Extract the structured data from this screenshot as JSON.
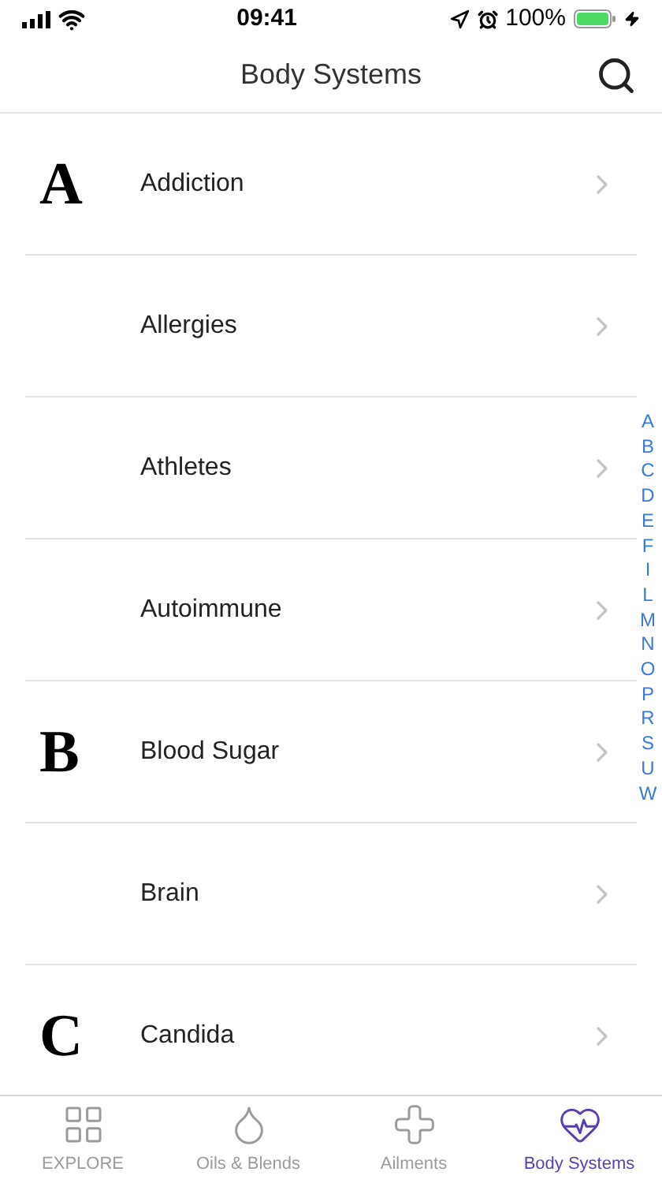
{
  "status_bar": {
    "time": "09:41",
    "battery": "100%"
  },
  "nav": {
    "title": "Body Systems"
  },
  "rows": [
    {
      "section": "A",
      "label": "Addiction"
    },
    {
      "label": "Allergies"
    },
    {
      "label": "Athletes"
    },
    {
      "label": "Autoimmune"
    },
    {
      "section": "B",
      "label": "Blood Sugar"
    },
    {
      "label": "Brain"
    },
    {
      "section": "C",
      "label": "Candida"
    }
  ],
  "index": [
    "A",
    "B",
    "C",
    "D",
    "E",
    "F",
    "I",
    "L",
    "M",
    "N",
    "O",
    "P",
    "R",
    "S",
    "U",
    "W"
  ],
  "tabs": [
    {
      "kind": "grid",
      "label": "EXPLORE",
      "selected": false
    },
    {
      "kind": "drop",
      "label": "Oils & Blends",
      "selected": false
    },
    {
      "kind": "cross",
      "label": "Ailments",
      "selected": false
    },
    {
      "kind": "heart",
      "label": "Body Systems",
      "selected": true
    }
  ]
}
